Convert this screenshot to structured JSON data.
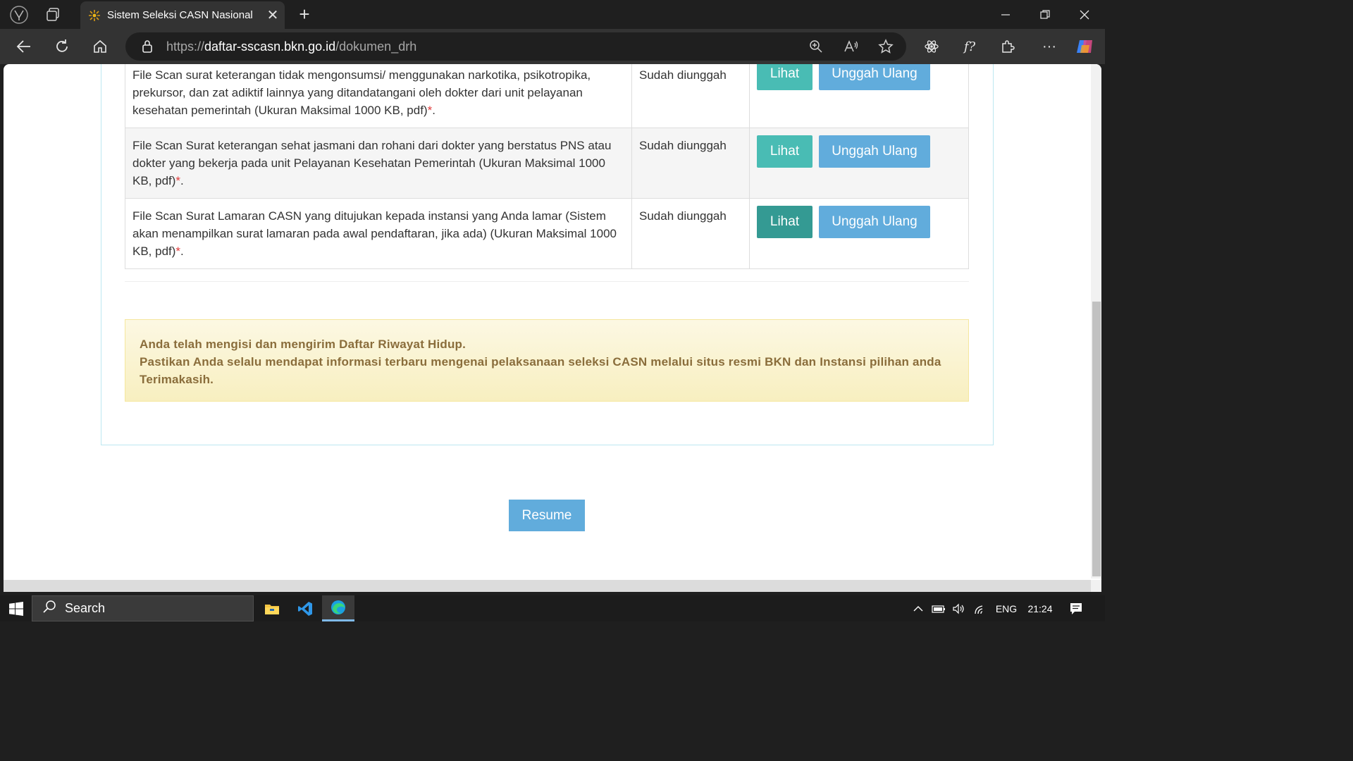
{
  "browser": {
    "tab_title": "Sistem Seleksi CASN Nasional",
    "url_scheme": "https://",
    "url_host": "daftar-sscasn.bkn.go.id",
    "url_path": "/dokumen_drh"
  },
  "documents": {
    "rows": [
      {
        "description": "File Scan surat keterangan tidak mengonsumsi/ menggunakan narkotika, psikotropika, prekursor, dan zat adiktif lainnya yang ditandatangani oleh dokter dari unit pelayanan kesehatan pemerintah (Ukuran Maksimal 1000 KB, pdf)",
        "required_mark": "*",
        "end": ".",
        "status": "Sudah diunggah",
        "view_label": "Lihat",
        "reupload_label": "Unggah Ulang"
      },
      {
        "description": "File Scan Surat keterangan sehat jasmani dan rohani dari dokter yang berstatus PNS atau dokter yang bekerja pada unit Pelayanan Kesehatan Pemerintah (Ukuran Maksimal 1000 KB, pdf)",
        "required_mark": "*",
        "end": ".",
        "status": "Sudah diunggah",
        "view_label": "Lihat",
        "reupload_label": "Unggah Ulang"
      },
      {
        "description": "File Scan Surat Lamaran CASN yang ditujukan kepada instansi yang Anda lamar (Sistem akan menampilkan surat lamaran pada awal pendaftaran, jika ada) (Ukuran Maksimal 1000 KB, pdf)",
        "required_mark": "*",
        "end": ".",
        "status": "Sudah diunggah",
        "view_label": "Lihat",
        "reupload_label": "Unggah Ulang"
      }
    ]
  },
  "notice": {
    "line1": "Anda telah mengisi dan mengirim Daftar Riwayat Hidup.",
    "line2": "Pastikan Anda selalu mendapat informasi terbaru mengenai pelaksanaan seleksi CASN melalui situs resmi BKN dan Instansi pilihan anda",
    "line3": "Terimakasih."
  },
  "resume_label": "Resume",
  "taskbar": {
    "search_label": "Search",
    "language": "ENG",
    "time": "21:24"
  },
  "colors": {
    "accent_teal": "#49bcb4",
    "accent_blue": "#61acdc",
    "notice_text": "#8a6d3b"
  }
}
